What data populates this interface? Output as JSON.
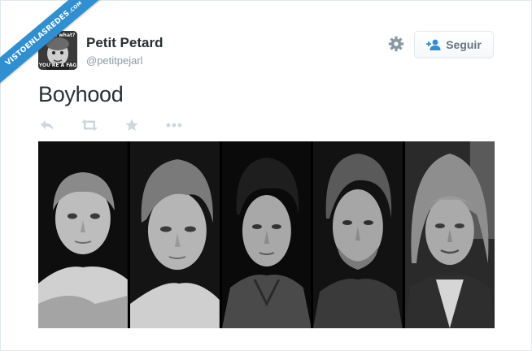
{
  "watermark": {
    "text": "VISTOENLASREDES",
    "suffix": ".COM"
  },
  "tweet": {
    "author_name": "Petit Petard",
    "author_handle": "@petitpejarl",
    "text": "Boyhood",
    "avatar_top_text": "Guess what?",
    "avatar_bottom_text": "YOU'RE A FAG"
  },
  "follow_button": {
    "label": "Seguir"
  },
  "icons": {
    "settings": "gear-icon",
    "follow": "add-user-icon",
    "reply": "reply-icon",
    "retweet": "retweet-icon",
    "favorite": "star-icon",
    "more": "more-icon"
  },
  "colors": {
    "accent": "#2f8fd1",
    "icon_gray": "#ccd6dd",
    "text": "#292f33",
    "muted": "#8899a6"
  },
  "media": {
    "panels": [
      {
        "description_name": "boy-age-6"
      },
      {
        "description_name": "boy-age-9"
      },
      {
        "description_name": "teen-age-15"
      },
      {
        "description_name": "young-man-age-18"
      },
      {
        "description_name": "older-woman-face"
      }
    ]
  }
}
